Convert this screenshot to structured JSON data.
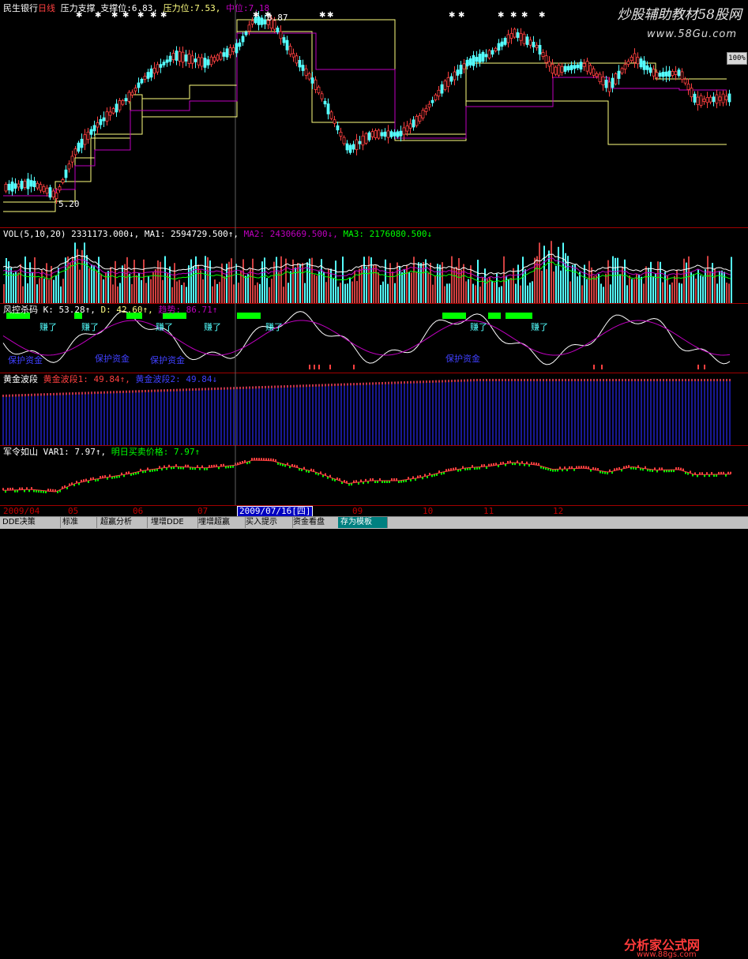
{
  "main_chart": {
    "stock_name": "民生银行",
    "period": "日线",
    "pressure_support": "压力支撑",
    "support_label": "支撑位:",
    "support_value": "6.83,",
    "pressure_label": "压力位:",
    "pressure_value": "7.53,",
    "mid_label": "中位:",
    "mid_value": "7.18",
    "high_mark": "8.87",
    "low_mark": "5.20"
  },
  "volume": {
    "title": "VOL(5,10,20)",
    "vol_value": "2331173.000↓,",
    "ma1": "MA1: 2594729.500↑,",
    "ma2": "MA2: 2430669.500↓,",
    "ma3": "MA3: 2176080.500↓"
  },
  "risk": {
    "title": "风控杀码",
    "k": "K: 53.28↑,",
    "d": "D: 42.60↑,",
    "trend": "趋势: 86.71↑",
    "earn_label": "赚了",
    "protect_label": "保护资金"
  },
  "gold": {
    "title": "黄金波段",
    "band1": "黄金波段1: 49.84↑,",
    "band2": "黄金波段2: 49.84↓"
  },
  "army": {
    "title": "军令如山",
    "var1": "VAR1: 7.97↑,",
    "tomorrow": "明日买卖价格: 7.97↑"
  },
  "dates": {
    "labels": [
      "2009/04",
      "05",
      "06",
      "07",
      "09",
      "10",
      "11",
      "12"
    ],
    "cursor": "2009/07/16[四]"
  },
  "tabs": [
    "DDE决策",
    "标准",
    "超赢分析",
    "埋增DDE",
    "埋增超赢",
    "买入提示",
    "资金看盘",
    "存为模板"
  ],
  "watermarks": {
    "site_cn": "炒股辅助教材58股网",
    "site_url": "www.58Gu.com",
    "pct": "100%",
    "brand": "分析家公式网",
    "brand_url": "www.88gs.com"
  },
  "colors": {
    "up": "#ff4040",
    "down": "#54ffff",
    "yellow": "#ffff80",
    "purple": "#c000c0",
    "green": "#00ff00"
  }
}
